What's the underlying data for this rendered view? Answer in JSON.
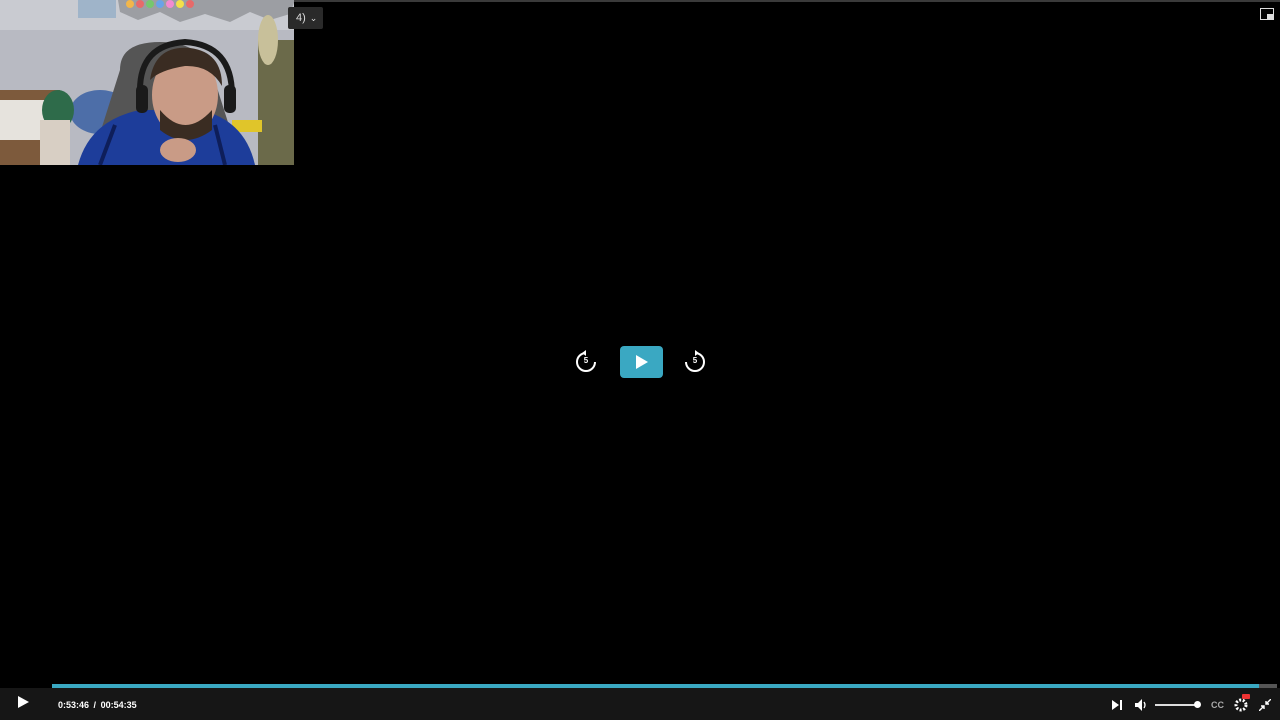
{
  "player": {
    "source_selector": "4)",
    "current_time": "0:53:46",
    "separator": "/",
    "duration": "00:54:35",
    "progress_fraction": 0.985,
    "volume_fraction": 0.98,
    "skip_back_seconds": "5",
    "skip_forward_seconds": "5",
    "cc_label": "CC",
    "accent_color": "#3aa8c2"
  },
  "icons": {
    "picture_in_picture": "pip-icon",
    "play": "play-icon",
    "skip_back": "replay-5-icon",
    "skip_forward": "forward-5-icon",
    "next": "next-icon",
    "volume": "volume-icon",
    "settings": "gear-icon",
    "exit_fullscreen": "exit-fullscreen-icon"
  }
}
